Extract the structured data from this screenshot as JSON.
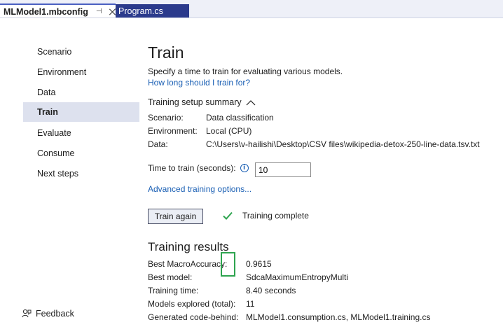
{
  "tabs": {
    "active_label": "MLModel1.mbconfig",
    "pin_glyph": "⊣",
    "inactive_label": "Program.cs"
  },
  "nav": {
    "items": [
      "Scenario",
      "Environment",
      "Data",
      "Train",
      "Evaluate",
      "Consume",
      "Next steps"
    ],
    "selected": "Train",
    "feedback_label": "Feedback"
  },
  "main": {
    "title": "Train",
    "description": "Specify a time to train for evaluating various models.",
    "how_long_link": "How long should I train for?",
    "summary_header": "Training setup summary",
    "summary": {
      "scenario_label": "Scenario:",
      "scenario_value": "Data classification",
      "environment_label": "Environment:",
      "environment_value": "Local (CPU)",
      "data_label": "Data:",
      "data_value": "C:\\Users\\v-hailishi\\Desktop\\CSV files\\wikipedia-detox-250-line-data.tsv.txt"
    },
    "time_to_train_label": "Time to train (seconds):",
    "info_glyph": "i",
    "time_to_train_value": "10",
    "advanced_link": "Advanced training options...",
    "train_button": "Train again",
    "status_text": "Training complete"
  },
  "results": {
    "title": "Training results",
    "best_accuracy_label": "Best MacroAccuracy:",
    "best_accuracy_value": "0.9615",
    "best_model_label": "Best model:",
    "best_model_value": "SdcaMaximumEntropyMulti",
    "training_time_label": "Training time:",
    "training_time_value": "8.40 seconds",
    "models_explored_label": "Models explored (total):",
    "models_explored_value": "11",
    "code_behind_label": "Generated code-behind:",
    "code_behind_value": "MLModel1.consumption.cs, MLModel1.training.cs"
  },
  "colors": {
    "accent": "#4a5fc1",
    "link": "#1a5fb4",
    "selected_nav": "#dde1ee",
    "inactive_tab": "#2b3a8c",
    "check": "#2ea44f",
    "highlight": "#2ea44f"
  },
  "icons": {
    "pin": "pin-icon",
    "close": "close-icon",
    "collapse": "chevron-up-icon",
    "info": "info-icon",
    "status": "checkmark-icon",
    "feedback": "feedback-icon"
  }
}
